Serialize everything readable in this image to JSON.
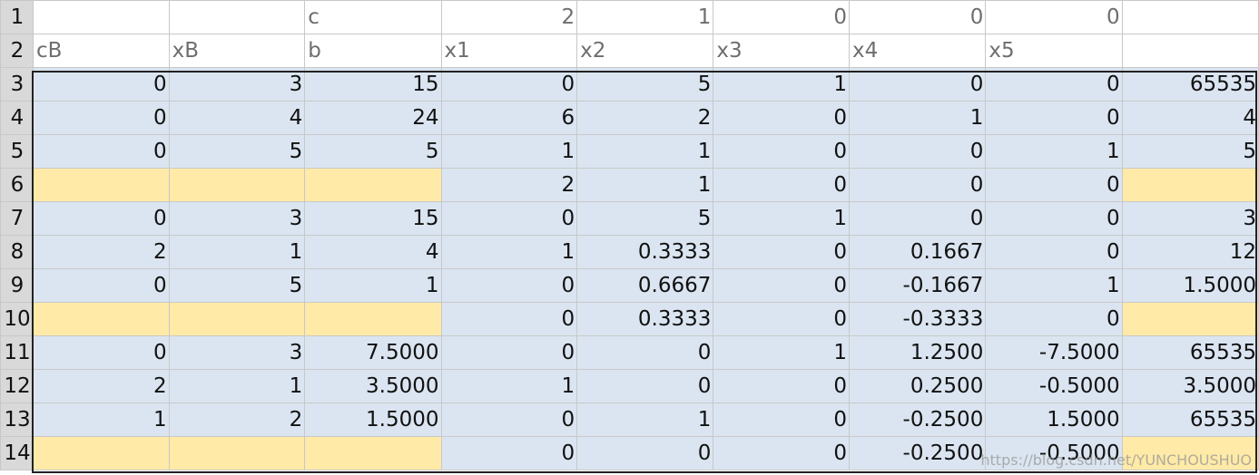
{
  "rows": [
    {
      "label": "1",
      "cells": [
        "",
        "",
        "c",
        "2",
        "1",
        "0",
        "0",
        "0",
        ""
      ]
    },
    {
      "label": "2",
      "cells": [
        "cB",
        "xB",
        "b",
        "x1",
        "x2",
        "x3",
        "x4",
        "x5",
        ""
      ]
    },
    {
      "label": "3",
      "cells": [
        "0",
        "3",
        "15",
        "0",
        "5",
        "1",
        "0",
        "0",
        "65535"
      ]
    },
    {
      "label": "4",
      "cells": [
        "0",
        "4",
        "24",
        "6",
        "2",
        "0",
        "1",
        "0",
        "4"
      ]
    },
    {
      "label": "5",
      "cells": [
        "0",
        "5",
        "5",
        "1",
        "1",
        "0",
        "0",
        "1",
        "5"
      ]
    },
    {
      "label": "6",
      "cells": [
        "",
        "",
        "",
        "2",
        "1",
        "0",
        "0",
        "0",
        ""
      ]
    },
    {
      "label": "7",
      "cells": [
        "0",
        "3",
        "15",
        "0",
        "5",
        "1",
        "0",
        "0",
        "3"
      ]
    },
    {
      "label": "8",
      "cells": [
        "2",
        "1",
        "4",
        "1",
        "0.3333",
        "0",
        "0.1667",
        "0",
        "12"
      ]
    },
    {
      "label": "9",
      "cells": [
        "0",
        "5",
        "1",
        "0",
        "0.6667",
        "0",
        "-0.1667",
        "1",
        "1.5000"
      ]
    },
    {
      "label": "10",
      "cells": [
        "",
        "",
        "",
        "0",
        "0.3333",
        "0",
        "-0.3333",
        "0",
        ""
      ]
    },
    {
      "label": "11",
      "cells": [
        "0",
        "3",
        "7.5000",
        "0",
        "0",
        "1",
        "1.2500",
        "-7.5000",
        "65535"
      ]
    },
    {
      "label": "12",
      "cells": [
        "2",
        "1",
        "3.5000",
        "1",
        "0",
        "0",
        "0.2500",
        "-0.5000",
        "3.5000"
      ]
    },
    {
      "label": "13",
      "cells": [
        "1",
        "2",
        "1.5000",
        "0",
        "1",
        "0",
        "-0.2500",
        "1.5000",
        "65535"
      ]
    },
    {
      "label": "14",
      "cells": [
        "",
        "",
        "",
        "0",
        "0",
        "0",
        "-0.2500",
        "-0.5000",
        ""
      ]
    }
  ],
  "colors": {
    "data_fill": "#dbe5f1",
    "objective_fill": "#ffeaa7",
    "row_header_fill": "#d9d9d9"
  },
  "watermark": "https://blog.csdn.net/YUNCHOUSHUO"
}
